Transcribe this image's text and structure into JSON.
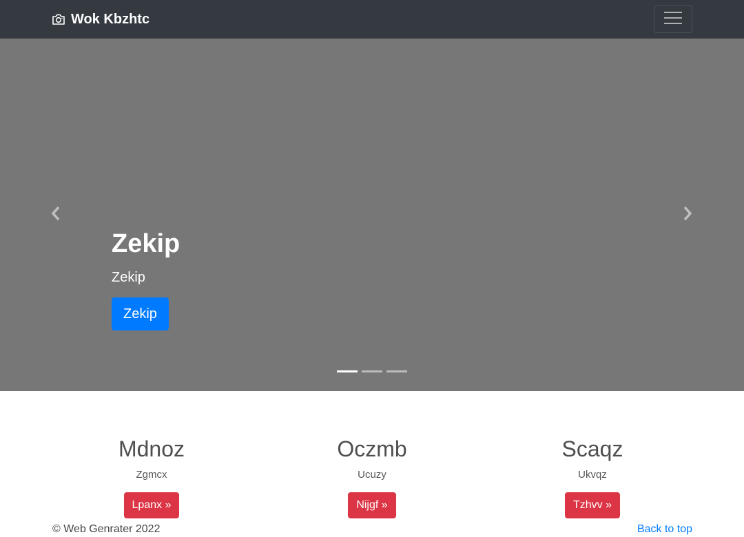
{
  "navbar": {
    "brand": "Wok Kbzhtc",
    "brand_icon": "camera-icon",
    "toggler_icon": "hamburger-menu-icon"
  },
  "carousel": {
    "title": "Zekip",
    "subtitle": "Zekip",
    "button_label": "Zekip",
    "prev_icon": "chevron-left-icon",
    "next_icon": "chevron-right-icon",
    "indicator_count": 3,
    "active_indicator": 1,
    "background_color": "#777777"
  },
  "columns": [
    {
      "heading": "Mdnoz",
      "text": "Zgmcx",
      "button_label": "Lpanx »"
    },
    {
      "heading": "Oczmb",
      "text": "Ucuzy",
      "button_label": "Nijgf »"
    },
    {
      "heading": "Scaqz",
      "text": "Ukvqz",
      "button_label": "Tzhvv »"
    }
  ],
  "footer": {
    "copyright": "© Web Genrater 2022",
    "back_to_top": "Back to top"
  },
  "colors": {
    "navbar": "#343a40",
    "primary": "#007bff",
    "danger": "#dc3545"
  }
}
